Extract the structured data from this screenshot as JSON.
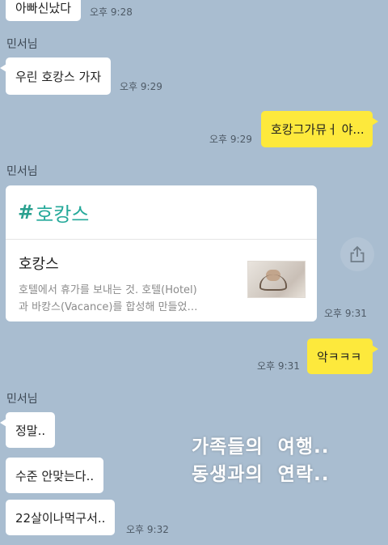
{
  "messages": {
    "m0": {
      "text": "아빠신났다",
      "time": "오후 9:28"
    },
    "sender1": "민서님",
    "m1": {
      "text": "우린 호캉스 가자",
      "time": "오후 9:29"
    },
    "m2": {
      "text": "호캉그가뮤ㅓ 야...",
      "time": "오후 9:29"
    },
    "sender2": "민서님",
    "card": {
      "hashtag": "#",
      "header": "호캉스",
      "title": "호캉스",
      "desc_line1": "호텔에서 휴가를 보내는 것. 호텔(Hotel)",
      "desc_line2": "과 바캉스(Vacance)를 합성해 만들었…",
      "time": "오후 9:31"
    },
    "m3": {
      "text": "악ㅋㅋㅋ",
      "time": "오후 9:31"
    },
    "sender3": "민서님",
    "m4": {
      "text": "정말.."
    },
    "m5": {
      "text": "수준 안맞는다.."
    },
    "m6": {
      "text": "22살이나먹구서..",
      "time": "오후 9:32"
    }
  },
  "overlay": {
    "line1": "가족들의  여행..",
    "line2": "동생과의  연락.."
  },
  "icons": {
    "share": "share-icon"
  },
  "colors": {
    "background": "#a9bdd0",
    "outgoing_bubble": "#fde93c",
    "incoming_bubble": "#ffffff",
    "hashtag": "#25a99a"
  }
}
